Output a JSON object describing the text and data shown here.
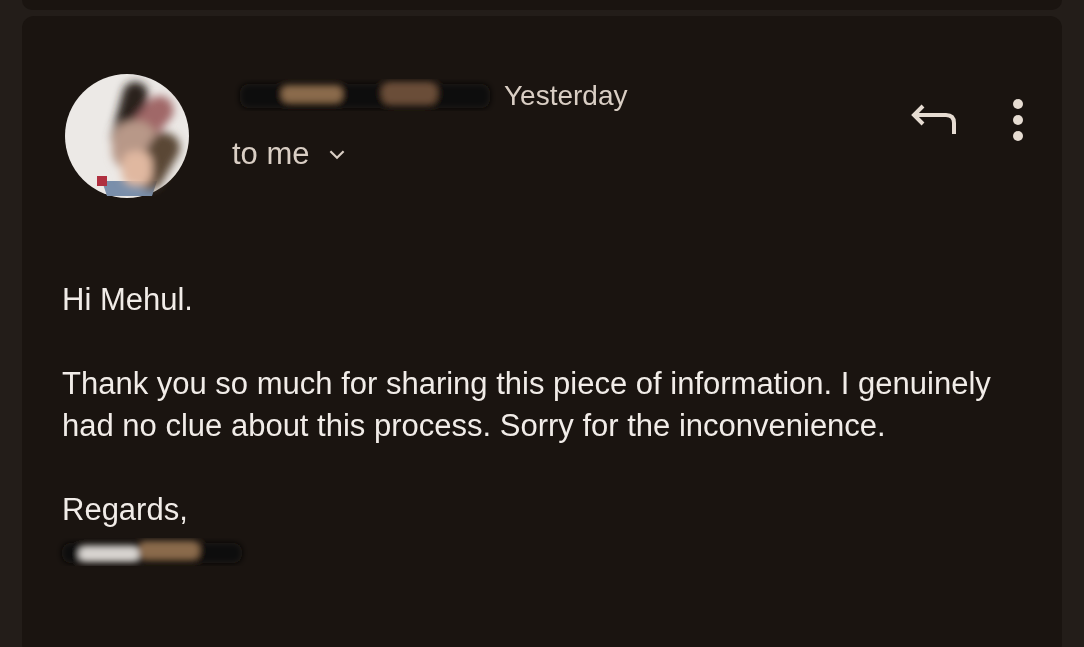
{
  "message": {
    "date": "Yesterday",
    "recipient": "to me",
    "recipient_expanded": false,
    "body": [
      "Hi Mehul.",
      "Thank you so much for sharing this piece of information. I genuinely had no clue about this process. Sorry for the inconvenience.",
      "Regards,"
    ]
  }
}
